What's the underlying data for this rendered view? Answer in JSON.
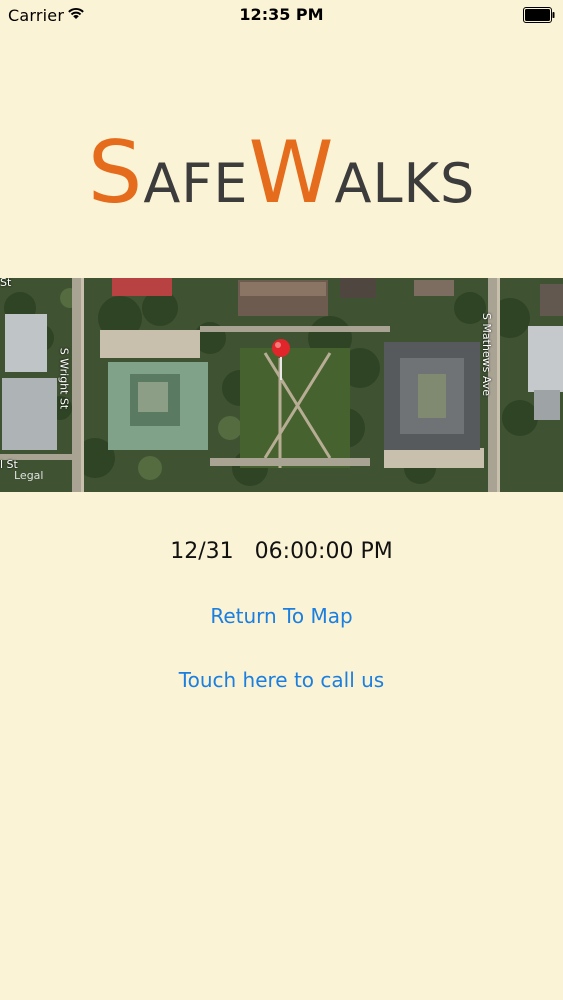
{
  "status_bar": {
    "carrier": "Carrier",
    "time": "12:35 PM"
  },
  "logo": {
    "part1_cap": "S",
    "part1_rest": "AFE",
    "part2_cap": "W",
    "part2_rest": "ALKS",
    "accent_color": "#e46c1c",
    "text_color": "#3c3c3c"
  },
  "map": {
    "labels": {
      "top_left": "St",
      "wright": "S Wright St",
      "mathews": "S Mathews Ave",
      "bottom_left": "l St",
      "legal": "Legal"
    }
  },
  "detail": {
    "date": "12/31",
    "time": "06:00:00 PM"
  },
  "actions": {
    "return_to_map": "Return To Map",
    "call_us": "Touch here to call us",
    "link_color": "#1a7fe0"
  },
  "colors": {
    "background": "#fbf3d5"
  }
}
